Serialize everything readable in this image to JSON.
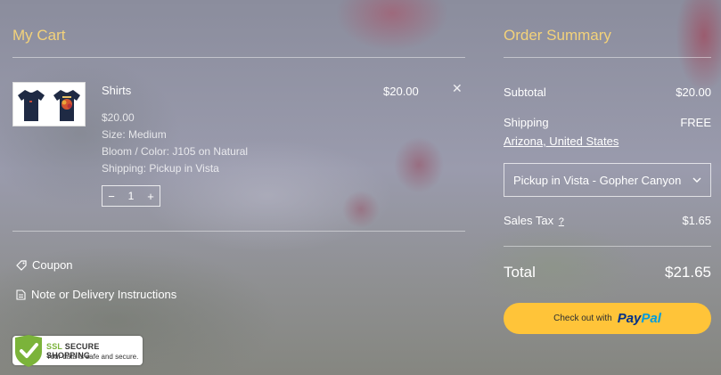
{
  "cart": {
    "title": "My Cart",
    "item": {
      "name": "Shirts",
      "price": "$20.00",
      "unit_price": "$20.00",
      "size": "Size: Medium",
      "color": "Bloom / Color: J105 on Natural",
      "shipping": "Shipping: Pickup in Vista",
      "quantity": "1",
      "remove_symbol": "✕",
      "decrement_symbol": "−",
      "increment_symbol": "+"
    },
    "coupon_label": "Coupon",
    "note_label": "Note or Delivery Instructions"
  },
  "summary": {
    "title": "Order Summary",
    "subtotal_label": "Subtotal",
    "subtotal_value": "$20.00",
    "shipping_label": "Shipping",
    "shipping_value": "FREE",
    "shipping_location": "Arizona, United States",
    "shipping_option": "Pickup in Vista - Gopher Canyon",
    "tax_label": "Sales Tax",
    "tax_help": "?",
    "tax_value": "$1.65",
    "total_label": "Total",
    "total_value": "$21.65"
  },
  "checkout": {
    "prefix": "Check out with",
    "brand_pay": "Pay",
    "brand_pal": "Pal"
  },
  "badge": {
    "title_ssl": "SSL",
    "title_rest": " SECURE SHOPPING",
    "subtitle": "Your data is safe and secure."
  },
  "colors": {
    "heading": "#f3d27a",
    "paypal_button": "#ffc439",
    "paypal_dark": "#003087",
    "paypal_light": "#009cde"
  }
}
